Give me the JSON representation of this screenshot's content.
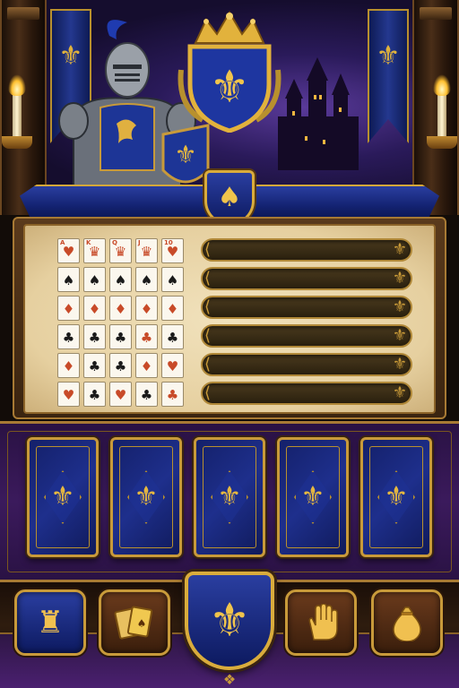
{
  "scene": {
    "banner_icon": "fleur-de-lis-icon",
    "crest_icon": "fleur-de-lis-icon",
    "ribbon_icon": "spade-icon"
  },
  "paytable": {
    "rows": [
      {
        "cards": [
          {
            "rank": "A",
            "suit": "♥",
            "color": "red"
          },
          {
            "rank": "K",
            "suit": "♛",
            "color": "red"
          },
          {
            "rank": "Q",
            "suit": "♛",
            "color": "red"
          },
          {
            "rank": "J",
            "suit": "♛",
            "color": "red"
          },
          {
            "rank": "10",
            "suit": "♥",
            "color": "red"
          }
        ],
        "payout": ""
      },
      {
        "cards": [
          {
            "rank": "",
            "suit": "♠",
            "color": "blk"
          },
          {
            "rank": "",
            "suit": "♠",
            "color": "blk"
          },
          {
            "rank": "",
            "suit": "♠",
            "color": "blk"
          },
          {
            "rank": "",
            "suit": "♠",
            "color": "blk"
          },
          {
            "rank": "",
            "suit": "♠",
            "color": "blk"
          }
        ],
        "payout": ""
      },
      {
        "cards": [
          {
            "rank": "",
            "suit": "♦",
            "color": "red"
          },
          {
            "rank": "",
            "suit": "♦",
            "color": "red"
          },
          {
            "rank": "",
            "suit": "♦",
            "color": "red"
          },
          {
            "rank": "",
            "suit": "♦",
            "color": "red"
          },
          {
            "rank": "",
            "suit": "♦",
            "color": "red"
          }
        ],
        "payout": ""
      },
      {
        "cards": [
          {
            "rank": "",
            "suit": "♣",
            "color": "blk"
          },
          {
            "rank": "",
            "suit": "♣",
            "color": "blk"
          },
          {
            "rank": "",
            "suit": "♣",
            "color": "blk"
          },
          {
            "rank": "",
            "suit": "♣",
            "color": "red"
          },
          {
            "rank": "",
            "suit": "♣",
            "color": "blk"
          }
        ],
        "payout": ""
      },
      {
        "cards": [
          {
            "rank": "",
            "suit": "♦",
            "color": "red"
          },
          {
            "rank": "",
            "suit": "♣",
            "color": "blk"
          },
          {
            "rank": "",
            "suit": "♣",
            "color": "blk"
          },
          {
            "rank": "",
            "suit": "♦",
            "color": "red"
          },
          {
            "rank": "",
            "suit": "♥",
            "color": "red"
          }
        ],
        "payout": ""
      },
      {
        "cards": [
          {
            "rank": "",
            "suit": "♥",
            "color": "red"
          },
          {
            "rank": "",
            "suit": "♣",
            "color": "blk"
          },
          {
            "rank": "",
            "suit": "♥",
            "color": "red"
          },
          {
            "rank": "",
            "suit": "♣",
            "color": "blk"
          },
          {
            "rank": "",
            "suit": "♣",
            "color": "red"
          }
        ],
        "payout": ""
      }
    ]
  },
  "hand": {
    "card_back_icon": "fleur-de-lis-icon",
    "count": 5
  },
  "controls": {
    "buttons": [
      {
        "name": "castle-button",
        "icon": "castle-icon",
        "glyph": "♜"
      },
      {
        "name": "cards-button",
        "icon": "cards-icon",
        "glyph": "🂡"
      },
      {
        "name": "deal-button",
        "icon": "fleur-de-lis-icon",
        "glyph": "⚜"
      },
      {
        "name": "hold-button",
        "icon": "hand-icon",
        "glyph": "✋"
      },
      {
        "name": "bag-button",
        "icon": "money-bag-icon",
        "glyph": "💰"
      }
    ]
  },
  "colors": {
    "royal_blue": "#1e2f8c",
    "gold": "#d9ac3c",
    "parchment": "#f1e2bd",
    "purple": "#3b1a5c",
    "wood": "#4a2e18"
  }
}
